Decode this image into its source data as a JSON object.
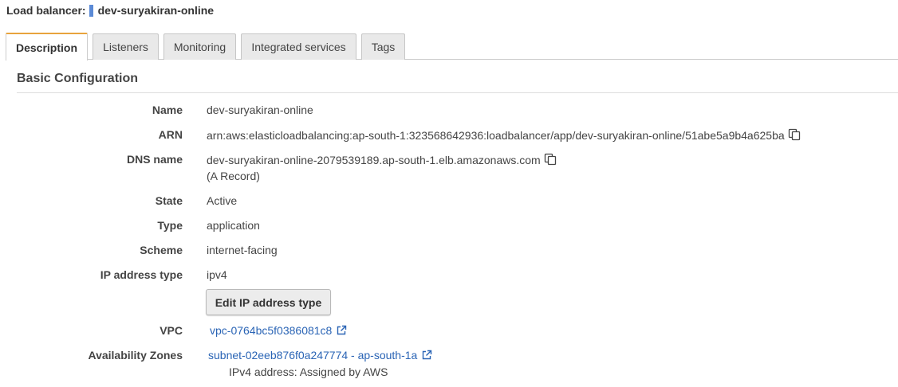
{
  "header": {
    "label": "Load balancer:",
    "name": "dev-suryakiran-online"
  },
  "tabs": [
    {
      "label": "Description",
      "active": true
    },
    {
      "label": "Listeners",
      "active": false
    },
    {
      "label": "Monitoring",
      "active": false
    },
    {
      "label": "Integrated services",
      "active": false
    },
    {
      "label": "Tags",
      "active": false
    }
  ],
  "section": {
    "title": "Basic Configuration"
  },
  "fields": {
    "name": {
      "label": "Name",
      "value": "dev-suryakiran-online"
    },
    "arn": {
      "label": "ARN",
      "value": "arn:aws:elasticloadbalancing:ap-south-1:323568642936:loadbalancer/app/dev-suryakiran-online/51abe5a9b4a625ba"
    },
    "dns": {
      "label": "DNS name",
      "value": "dev-suryakiran-online-2079539189.ap-south-1.elb.amazonaws.com",
      "record": "(A Record)"
    },
    "state": {
      "label": "State",
      "value": "Active"
    },
    "type": {
      "label": "Type",
      "value": "application"
    },
    "scheme": {
      "label": "Scheme",
      "value": "internet-facing"
    },
    "ip_type": {
      "label": "IP address type",
      "value": "ipv4",
      "button": "Edit IP address type"
    },
    "vpc": {
      "label": "VPC",
      "value": "vpc-0764bc5f0386081c8"
    },
    "az": {
      "label": "Availability Zones",
      "subnet": "subnet-02eeb876f0a247774 - ap-south-1a",
      "ipv4": "IPv4 address: Assigned by AWS"
    }
  },
  "colors": {
    "accent": "#e8a33d",
    "link": "#2a64b5",
    "marker": "#5b8ad6"
  },
  "icons": {
    "copy": "copy-icon",
    "external": "external-link-icon"
  }
}
